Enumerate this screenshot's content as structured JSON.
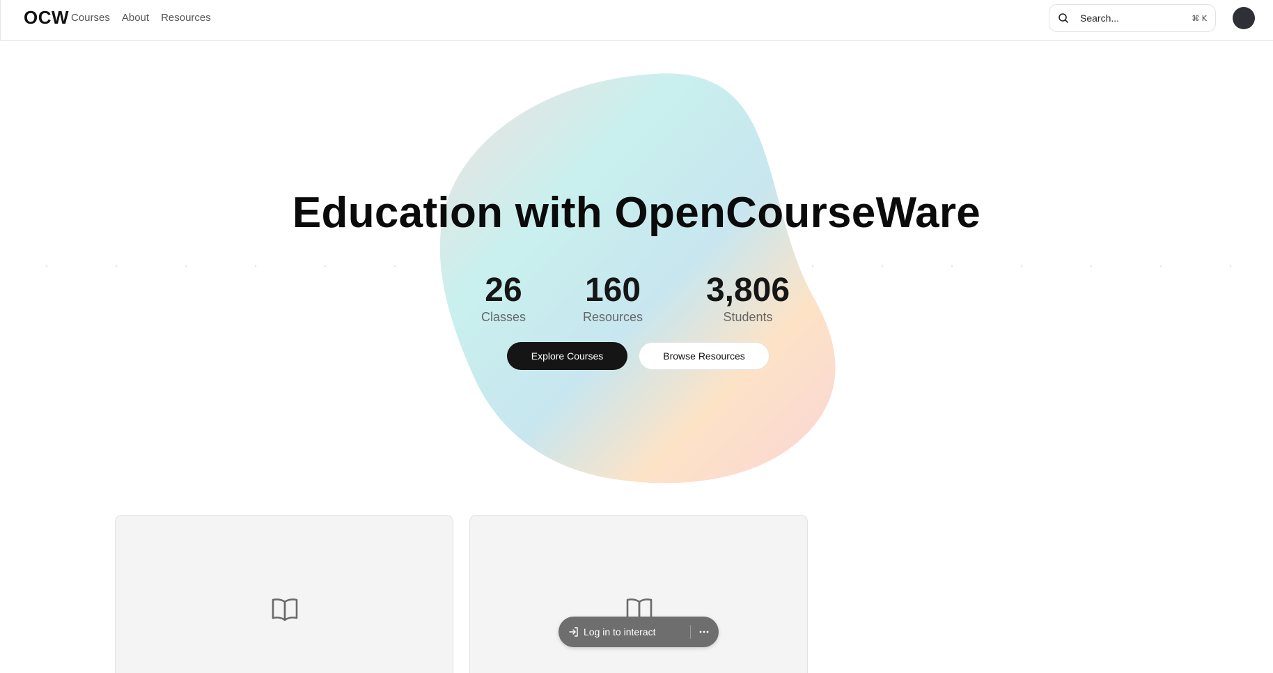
{
  "header": {
    "logo": "OCW",
    "nav": [
      {
        "label": "Courses"
      },
      {
        "label": "About"
      },
      {
        "label": "Resources"
      }
    ],
    "search": {
      "placeholder": "Search...",
      "shortcut": "⌘ K",
      "icon": "search-icon"
    },
    "avatar_color": "#2f2f37"
  },
  "hero": {
    "title": "Education with OpenCourseWare",
    "stats": [
      {
        "value": "26",
        "label": "Classes"
      },
      {
        "value": "160",
        "label": "Resources"
      },
      {
        "value": "3,806",
        "label": "Students"
      }
    ],
    "primary_button": "Explore Courses",
    "secondary_button": "Browse Resources",
    "blob_colors": [
      "#c9f0ee",
      "#c8e6ef",
      "#fde3c6",
      "#f9d4d6"
    ]
  },
  "cards": [
    {
      "icon": "book-open-icon"
    },
    {
      "icon": "book-open-icon"
    }
  ],
  "floating_bar": {
    "label": "Log in to interact",
    "icon": "log-in-icon",
    "more_icon": "more-horizontal-icon"
  },
  "colors": {
    "primary_button_bg": "#151515",
    "card_bg": "#f4f4f4",
    "pill_bg": "#6e6e6e"
  }
}
